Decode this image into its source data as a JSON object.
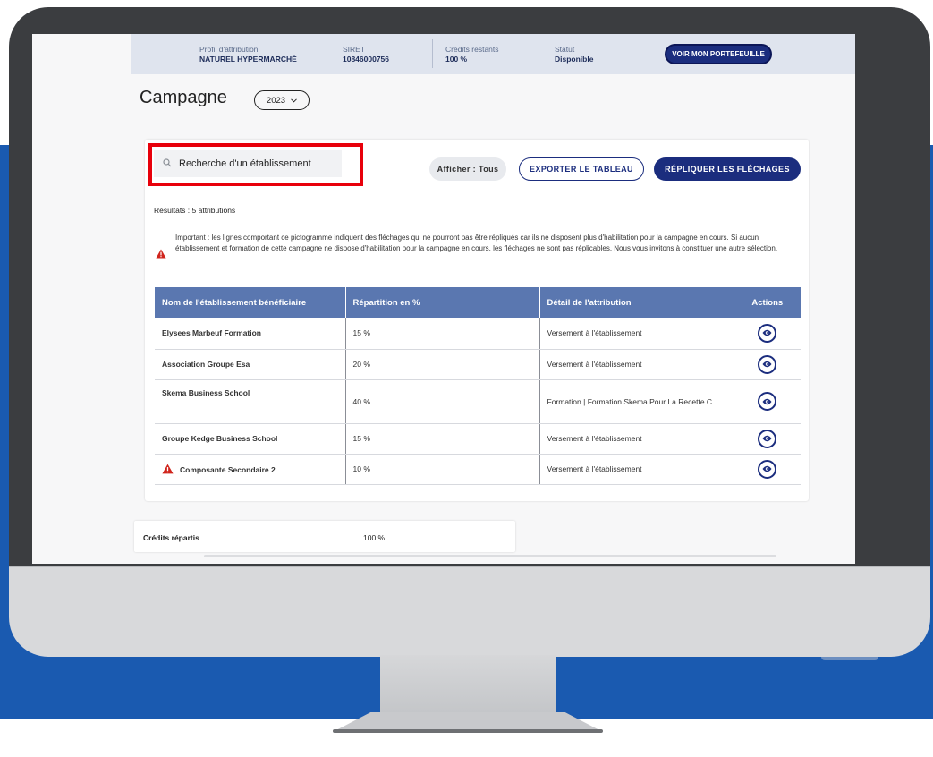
{
  "topbar": {
    "profil_label": "Profil d'attribution",
    "profil_value": "NATUREL HYPERMARCHÉ",
    "siret_label": "SIRET",
    "siret_value": "10846000756",
    "credits_label": "Crédits restants",
    "credits_value": "100 %",
    "statut_label": "Statut",
    "statut_value": "Disponible",
    "portefeuille_button": "VOIR MON PORTEFEUILLE"
  },
  "page": {
    "title": "Campagne",
    "year": "2023"
  },
  "toolbar": {
    "search_placeholder": "Recherche d'un établissement",
    "afficher_label": "Afficher : Tous",
    "export_label": "EXPORTER LE TABLEAU",
    "repliquer_label": "RÉPLIQUER LES FLÉCHAGES"
  },
  "results": {
    "count_text": "Résultats : 5 attributions",
    "important_text": "Important : les lignes comportant ce pictogramme indiquent des fléchages qui ne pourront pas être répliqués car ils ne disposent plus d'habilitation pour la campagne en cours. Si aucun établissement et formation de cette campagne ne dispose d'habilitation pour la campagne en cours, les fléchages ne sont pas réplicables. Nous vous invitons à constituer une autre sélection."
  },
  "table": {
    "headers": {
      "name": "Nom de l'établissement bénéficiaire",
      "repartition": "Répartition en %",
      "detail": "Détail de l'attribution",
      "actions": "Actions"
    },
    "rows": [
      {
        "name": "Elysees Marbeuf Formation",
        "repartition": "15 %",
        "detail": "Versement à l'établissement",
        "warning": false
      },
      {
        "name": "Association Groupe Esa",
        "repartition": "20 %",
        "detail": "Versement à l'établissement",
        "warning": false
      },
      {
        "name": "Skema Business School",
        "repartition": "40 %",
        "detail": "Formation | Formation Skema Pour La Recette C",
        "warning": false
      },
      {
        "name": "Groupe Kedge Business School",
        "repartition": "15 %",
        "detail": "Versement à l'établissement",
        "warning": false
      },
      {
        "name": "Composante Secondaire 2",
        "repartition": "10 %",
        "detail": "Versement à l'établissement",
        "warning": true
      }
    ]
  },
  "credits_repartis": {
    "label": "Crédits répartis",
    "value": "100 %"
  },
  "colors": {
    "primary": "#1b2d7e",
    "table_header": "#5a77b0",
    "link": "#1c48a4",
    "warning": "#d0241c",
    "highlight": "#e8000b",
    "background_band": "#1a5ab0"
  }
}
